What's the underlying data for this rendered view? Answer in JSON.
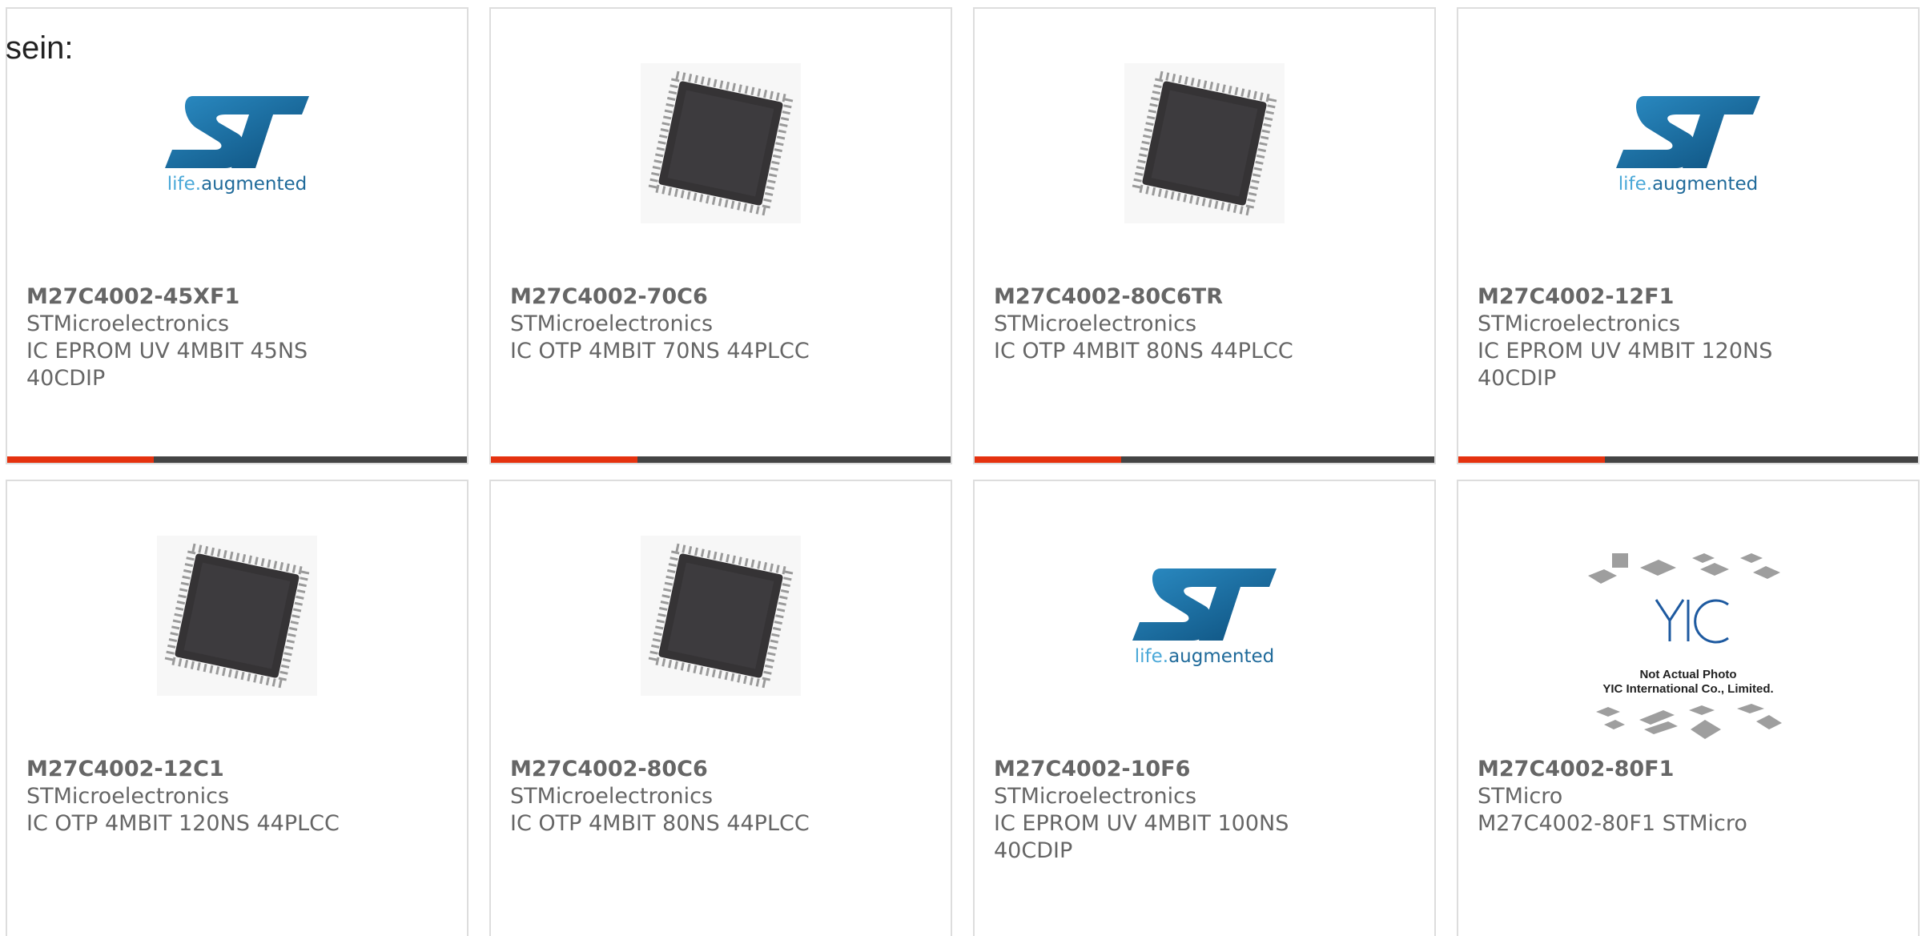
{
  "lead_text": "sein:",
  "products": [
    {
      "part": "M27C4002-45XF1",
      "maker": "STMicroelectronics",
      "desc": "IC EPROM UV 4MBIT 45NS 40CDIP",
      "image": "st-logo-icon",
      "has_bar": true
    },
    {
      "part": "M27C4002-70C6",
      "maker": "STMicroelectronics",
      "desc": "IC OTP 4MBIT 70NS 44PLCC",
      "image": "plcc-chip-icon",
      "has_bar": true
    },
    {
      "part": "M27C4002-80C6TR",
      "maker": "STMicroelectronics",
      "desc": "IC OTP 4MBIT 80NS 44PLCC",
      "image": "plcc-chip-icon",
      "has_bar": true
    },
    {
      "part": "M27C4002-12F1",
      "maker": "STMicroelectronics",
      "desc": "IC EPROM UV 4MBIT 120NS 40CDIP",
      "image": "st-logo-icon",
      "has_bar": true
    },
    {
      "part": "M27C4002-12C1",
      "maker": "STMicroelectronics",
      "desc": "IC OTP 4MBIT 120NS 44PLCC",
      "image": "plcc-chip-icon",
      "has_bar": false
    },
    {
      "part": "M27C4002-80C6",
      "maker": "STMicroelectronics",
      "desc": "IC OTP 4MBIT 80NS 44PLCC",
      "image": "plcc-chip-icon",
      "has_bar": false
    },
    {
      "part": "M27C4002-10F6",
      "maker": "STMicroelectronics",
      "desc": "IC EPROM UV 4MBIT 100NS 40CDIP",
      "image": "st-logo-icon",
      "has_bar": false
    },
    {
      "part": "M27C4002-80F1",
      "maker": "STMicro",
      "desc": "M27C4002-80F1 STMicro",
      "image": "yic-placeholder-icon",
      "has_bar": false
    }
  ],
  "logo": {
    "tag_prefix": "life.",
    "tag_suffix": "augmented"
  },
  "placeholder": {
    "line1": "Not Actual Photo",
    "line2": "YIC International Co., Limited."
  },
  "colors": {
    "accent": "#e5320f",
    "bar": "#444444",
    "text": "#666666",
    "st_blue": "#1f6a9a"
  }
}
